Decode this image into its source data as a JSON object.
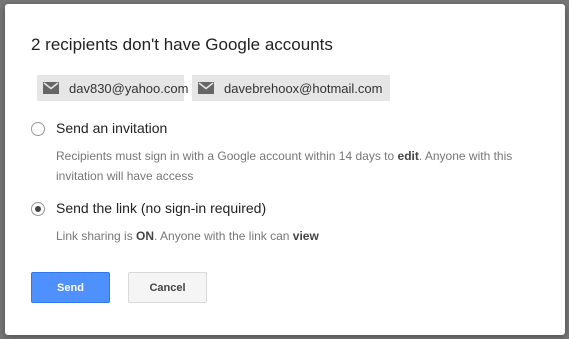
{
  "dialog": {
    "title": "2 recipients don't have Google accounts",
    "recipients": [
      {
        "email": "dav830@yahoo.com",
        "icon": "mail-icon"
      },
      {
        "email": "davebrehoox@hotmail.com",
        "icon": "mail-icon"
      }
    ],
    "options": [
      {
        "label": "Send an invitation",
        "selected": false,
        "desc_1": "Recipients must sign in with a Google account within 14 days to ",
        "desc_bold_1": "edit",
        "desc_2": ". Anyone with this invitation will have access"
      },
      {
        "label": "Send the link (no sign-in required)",
        "selected": true,
        "desc_1": "Link sharing is ",
        "desc_bold_1": "ON",
        "desc_2": ". Anyone with the link can ",
        "desc_bold_2": "view"
      }
    ],
    "buttons": {
      "send": "Send",
      "cancel": "Cancel"
    }
  },
  "colors": {
    "primary": "#4d90fe",
    "chip_bg": "#e6e6e6",
    "overlay": "#7a7a7a"
  }
}
